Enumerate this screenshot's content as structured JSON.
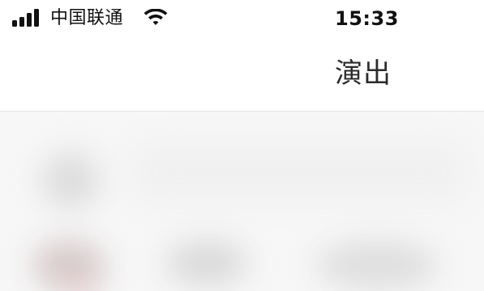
{
  "status_bar": {
    "carrier": "中国联通",
    "time": "15:33",
    "signal_icon": "signal-bars-icon",
    "wifi_icon": "wifi-icon"
  },
  "nav_bar": {
    "title": "演出"
  },
  "content": {
    "state": "blurred"
  }
}
